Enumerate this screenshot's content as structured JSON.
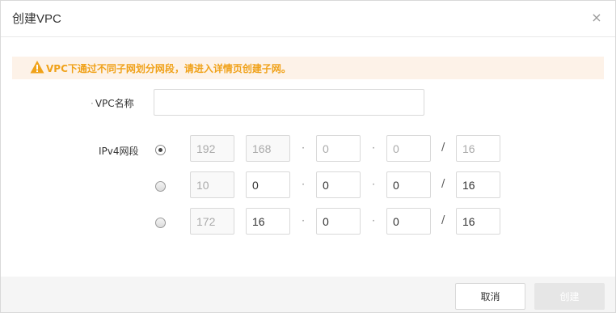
{
  "dialog": {
    "title": "创建VPC",
    "close_symbol": "×"
  },
  "warning": {
    "icon": "warning-icon",
    "text": "VPC下通过不同子网划分网段，请进入详情页创建子网。",
    "color": "#f0a21a"
  },
  "form": {
    "vpc_name_label": "VPC名称",
    "vpc_name_value": "",
    "ipv4_label": "IPv4网段",
    "separator_dot": "·",
    "separator_slash": "/",
    "options": [
      {
        "selected": true,
        "octets": [
          "192",
          "168",
          "0",
          "0"
        ],
        "prefix": "16"
      },
      {
        "selected": false,
        "octets": [
          "10",
          "0",
          "0",
          "0"
        ],
        "prefix": "16"
      },
      {
        "selected": false,
        "octets": [
          "172",
          "16",
          "0",
          "0"
        ],
        "prefix": "16"
      }
    ]
  },
  "footer": {
    "cancel_label": "取消",
    "create_label": "创建"
  }
}
